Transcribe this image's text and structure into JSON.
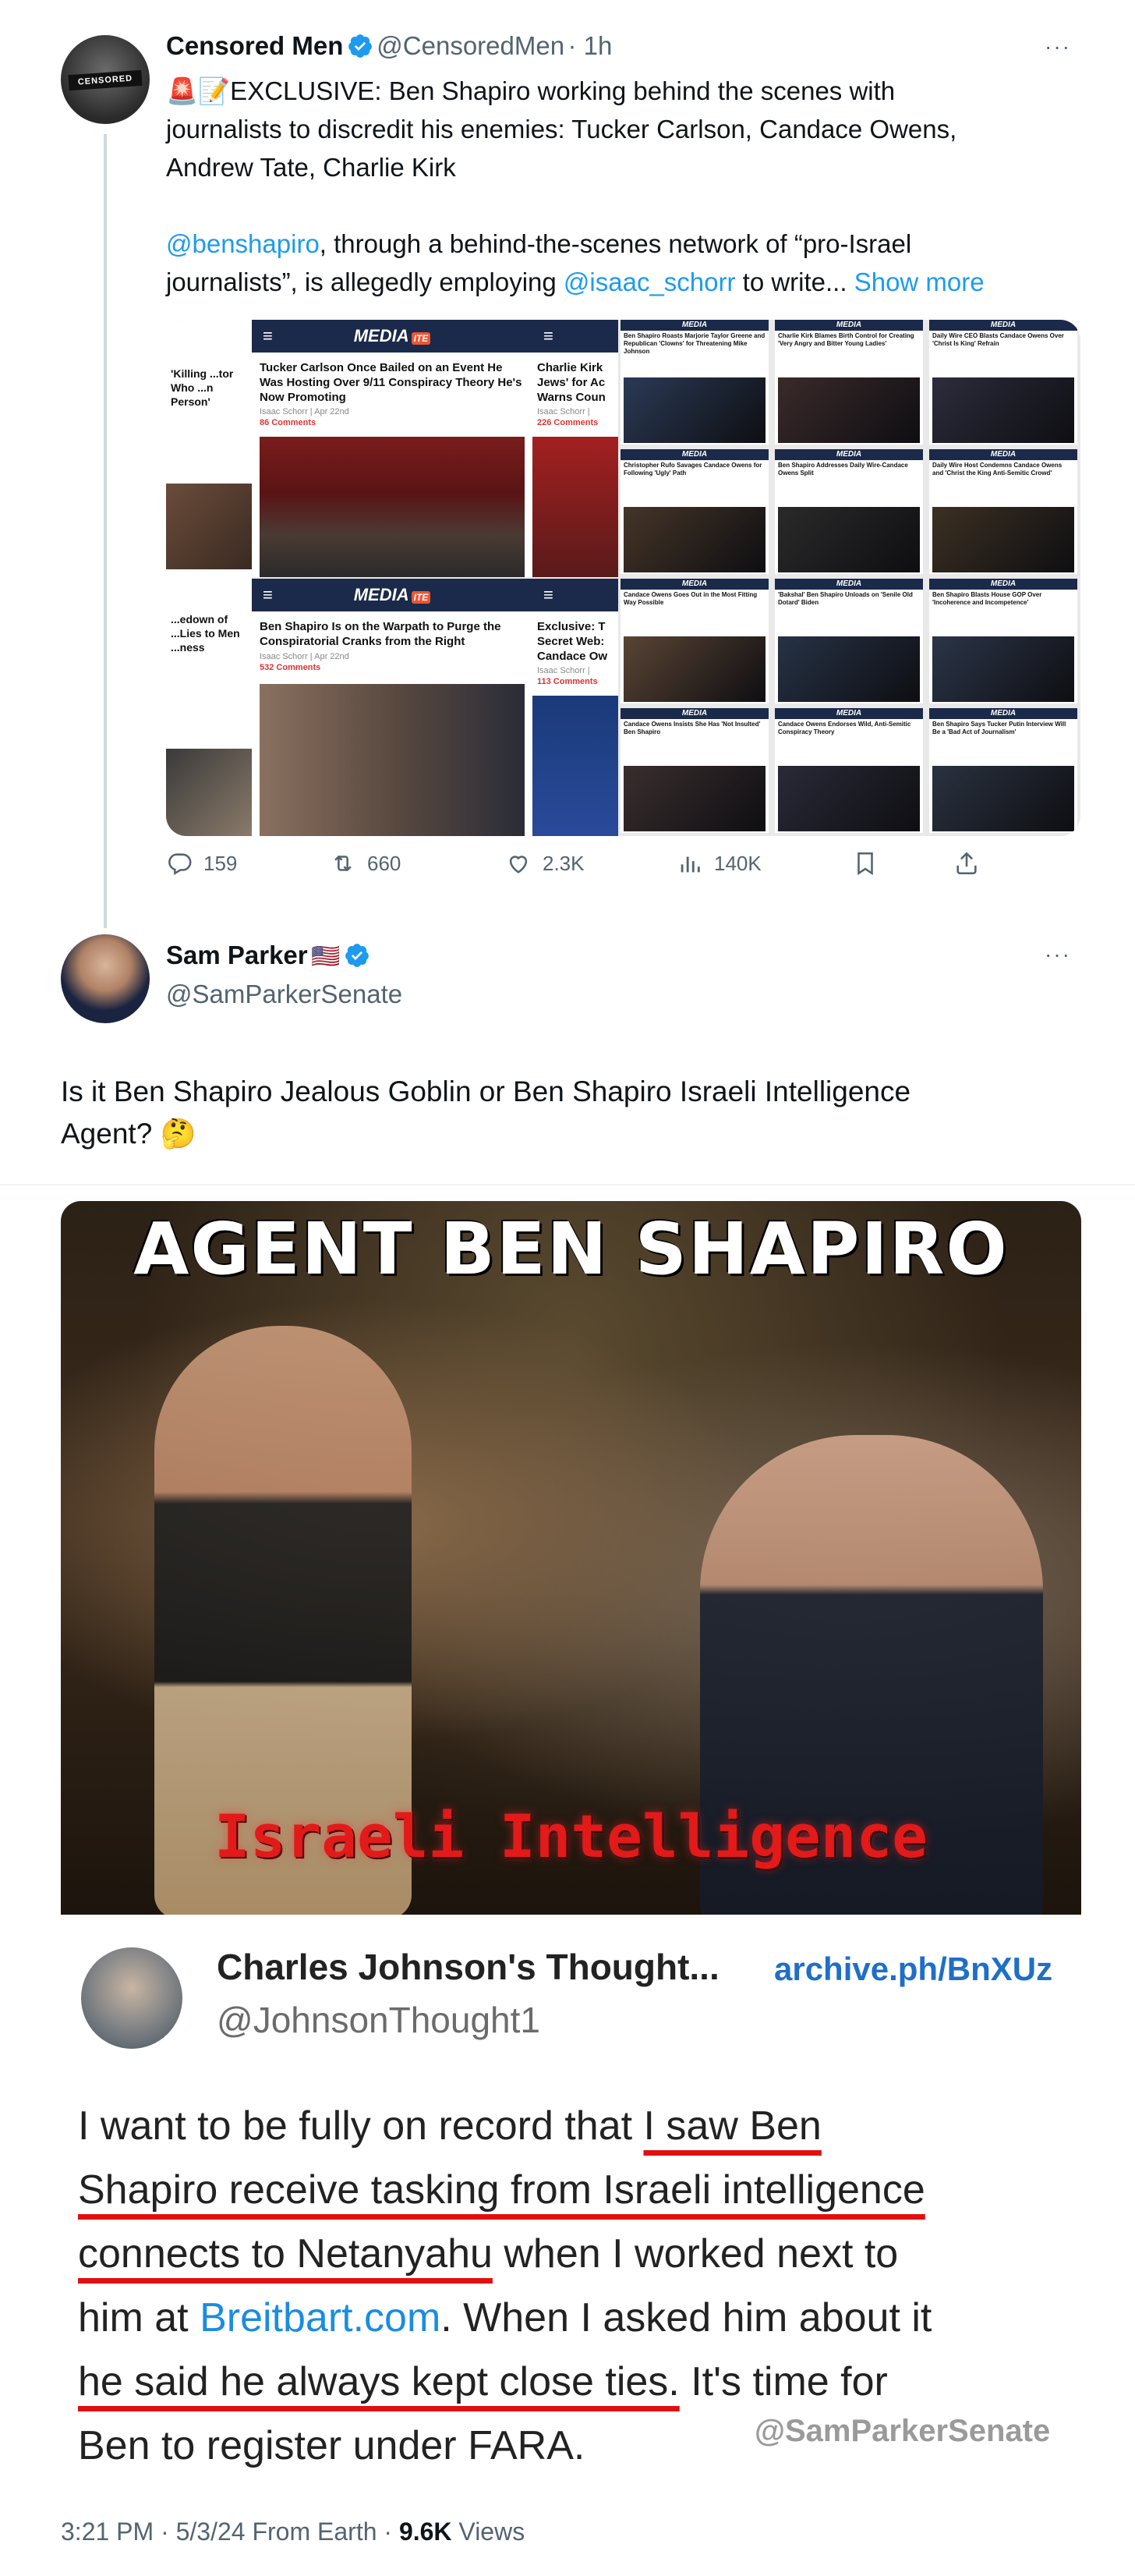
{
  "parent_tweet": {
    "author_name": "Censored Men",
    "author_handle": "@CensoredMen",
    "time": "· 1h",
    "avatar_text": "CENSORED",
    "more_label": "···",
    "text_line1": "🚨📝EXCLUSIVE: Ben Shapiro working behind the scenes with",
    "text_line2": "journalists to discredit his enemies: Tucker Carlson, Candace Owens,",
    "text_line3": "Andrew Tate, Charlie Kirk",
    "mention1": "@benshapiro",
    "text_line4_rest": ", through a behind-the-scenes network of “pro-Israel",
    "text_line5_start": "journalists”, is allegedly employing ",
    "mention2": "@isaac_schorr",
    "text_line5_end": " to write... ",
    "show_more": "Show more",
    "media": {
      "brand": "MEDIA",
      "brand_suffix": "ITE",
      "panels": [
        {
          "title": "Tucker Carlson Once Bailed on an Event He Was Hosting Over 9/11 Conspiracy Theory He's Now Promoting",
          "meta": "Isaac Schorr | Apr 22nd",
          "comments": "86 Comments"
        },
        {
          "title": "Ben Shapiro Is on the Warpath to Purge the Conspiratorial Cranks from the Right",
          "meta": "Isaac Schorr | Apr 22nd",
          "comments": "532 Comments"
        },
        {
          "title": "'Killing ...tor Who ...n Person'"
        },
        {
          "title": "...edown of ...Lies to Men ...ness"
        },
        {
          "title": "Charlie Kirk Jews' for Ac Warns Coun",
          "meta": "Isaac Schorr |",
          "comments": "226 Comments"
        },
        {
          "title": "Exclusive: T Secret Web: Candace Ow",
          "meta": "Isaac Schorr |",
          "comments": "113 Comments"
        }
      ],
      "thumbs": [
        "Ben Shapiro Roasts Marjorie Taylor Greene and Republican 'Clowns' for Threatening Mike Johnson",
        "Charlie Kirk Blames Birth Control for Creating 'Very Angry and Bitter Young Ladies'",
        "Daily Wire CEO Blasts Candace Owens Over 'Christ Is King' Refrain",
        "Christopher Rufo Savages Candace Owens for Following 'Ugly' Path",
        "Ben Shapiro Addresses Daily Wire-Candace Owens Split",
        "Daily Wire Host Condemns Candace Owens and 'Christ the King Anti-Semitic Crowd'",
        "Candace Owens Goes Out in the Most Fitting Way Possible",
        "'Bakshal' Ben Shapiro Unloads on 'Senile Old Dotard' Biden",
        "Ben Shapiro Blasts House GOP Over 'Incoherence and Incompetence'",
        "Candace Owens Insists She Has 'Not Insulted' Ben Shapiro",
        "Candace Owens Endorses Wild, Anti-Semitic Conspiracy Theory",
        "Ben Shapiro Says Tucker Putin Interview Will Be a 'Bad Act of Journalism'"
      ]
    },
    "actions": {
      "replies": "159",
      "reposts": "660",
      "likes": "2.3K",
      "views": "140K"
    }
  },
  "main_tweet": {
    "author_name": "Sam Parker",
    "flag": "🇺🇸",
    "author_handle": "@SamParkerSenate",
    "more_label": "···",
    "text_line1": "Is it Ben Shapiro Jealous Goblin or Ben Shapiro Israeli Intelligence",
    "text_line2": "Agent? 🤔",
    "image": {
      "title": "AGENT  BEN  SHAPIRO",
      "caption": "Israeli Intelligence"
    },
    "quoted": {
      "name": "Charles Johnson's Thought...",
      "handle": "@JohnsonThought1",
      "archive": "archive.ph/BnXUz",
      "p1": "I want to be fully on record that ",
      "u1": "I saw Ben",
      "u2": "Shapiro receive tasking from Israeli intelligence",
      "u3": "connects to Netanyahu",
      "p2": " when I worked next to",
      "p3": "him at ",
      "site": "Breitbart.com",
      "p4": ". When I asked him about it",
      "u4": "he said he always kept close ties.",
      "p5": " It's time for",
      "p6": "Ben to register under FARA.",
      "watermark": "@SamParkerSenate"
    },
    "footer": {
      "time_date": "3:21 PM · 5/3/24 From Earth · ",
      "views_count": "9.6K",
      "views_label": " Views"
    }
  },
  "colors": {
    "accent": "#1d9bf0",
    "text": "#0f1419",
    "muted": "#536471",
    "underline_red": "#e01010",
    "caption_red": "#e21a1a"
  },
  "icons": [
    "verified-icon",
    "reply-icon",
    "repost-icon",
    "like-icon",
    "views-icon",
    "bookmark-icon",
    "share-icon",
    "more-icon"
  ]
}
